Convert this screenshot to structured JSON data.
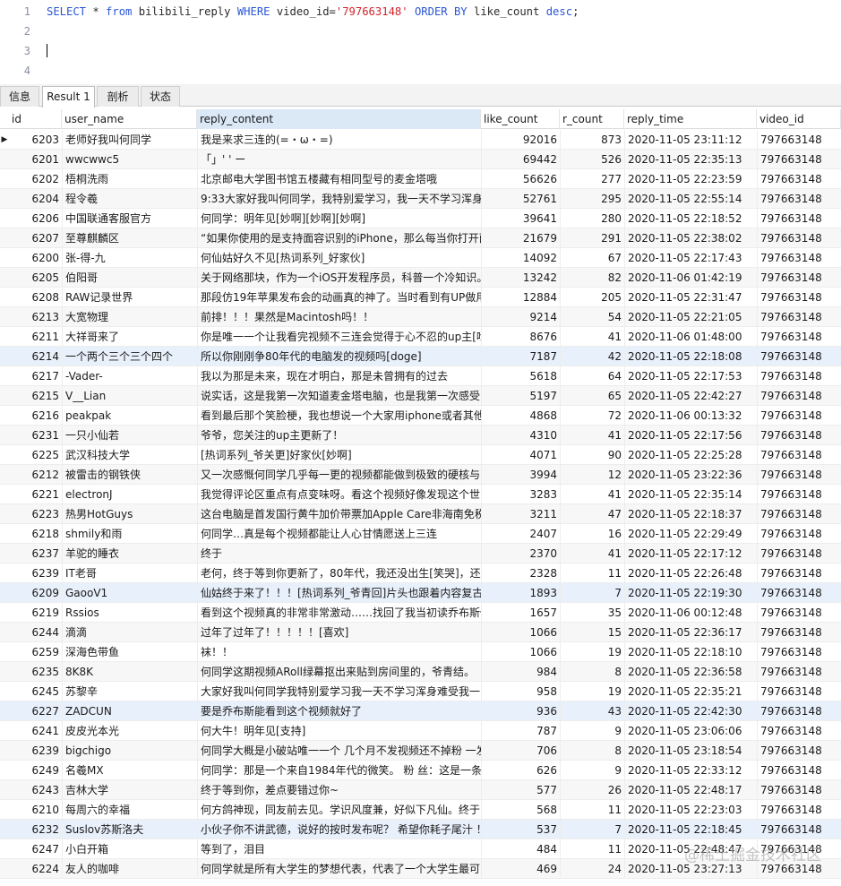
{
  "editor": {
    "lines": [
      {
        "num": "1",
        "tokens": [
          {
            "t": "SELECT",
            "c": "kw"
          },
          {
            "t": " * ",
            "c": "plain"
          },
          {
            "t": "from",
            "c": "kw"
          },
          {
            "t": " bilibili_reply ",
            "c": "plain"
          },
          {
            "t": "WHERE",
            "c": "kw"
          },
          {
            "t": " video_id=",
            "c": "plain"
          },
          {
            "t": "'797663148'",
            "c": "str"
          },
          {
            "t": " ",
            "c": "plain"
          },
          {
            "t": "ORDER BY",
            "c": "kw"
          },
          {
            "t": " like_count ",
            "c": "plain"
          },
          {
            "t": "desc",
            "c": "kw"
          },
          {
            "t": ";",
            "c": "plain"
          }
        ]
      },
      {
        "num": "2",
        "tokens": []
      },
      {
        "num": "3",
        "tokens": []
      },
      {
        "num": "4",
        "tokens": []
      }
    ]
  },
  "tabs": [
    "信息",
    "Result 1",
    "剖析",
    "状态"
  ],
  "columns": [
    "id",
    "user_name",
    "reply_content",
    "like_count",
    "r_count",
    "reply_time",
    "video_id"
  ],
  "row_pointer": "▶",
  "rows": [
    [
      "6203",
      "老师好我叫何同学",
      "我是来求三连的(=・ω・=)",
      "92016",
      "873",
      "2020-11-05 23:11:12",
      "797663148"
    ],
    [
      "6201",
      "wwcwwc5",
      "「」' ' ー",
      "69442",
      "526",
      "2020-11-05 22:35:13",
      "797663148"
    ],
    [
      "6202",
      "梧桐洗雨",
      "北京邮电大学图书馆五楼藏有相同型号的麦金塔哦",
      "56626",
      "277",
      "2020-11-05 22:23:59",
      "797663148"
    ],
    [
      "6204",
      "程令羲",
      "9:33大家好我叫何同学，我特别爱学习，我一天不学习浑身",
      "52761",
      "295",
      "2020-11-05 22:55:14",
      "797663148"
    ],
    [
      "6206",
      "中国联通客服官方",
      "何同学：明年见[妙啊][妙啊][妙啊]",
      "39641",
      "280",
      "2020-11-05 22:18:52",
      "797663148"
    ],
    [
      "6207",
      "至尊麒麟区",
      "“如果你使用的是支持面容识别的iPhone，那么每当你打开面",
      "21679",
      "291",
      "2020-11-05 22:38:02",
      "797663148"
    ],
    [
      "6200",
      "张-得-九",
      "何仙姑好久不见[热词系列_好家伙]",
      "14092",
      "67",
      "2020-11-05 22:17:43",
      "797663148"
    ],
    [
      "6205",
      "伯阳哥",
      "关于网络那块，作为一个iOS开发程序员，科普一个冷知识。",
      "13242",
      "82",
      "2020-11-06 01:42:19",
      "797663148"
    ],
    [
      "6208",
      "RAW记录世界",
      "那段仿19年苹果发布会的动画真的神了。当时看到有UP做用",
      "12884",
      "205",
      "2020-11-05 22:31:47",
      "797663148"
    ],
    [
      "6213",
      "大宽物理",
      "前排！！！果然是Macintosh吗！！",
      "9214",
      "54",
      "2020-11-05 22:21:05",
      "797663148"
    ],
    [
      "6211",
      "大祥哥来了",
      "你是唯一一个让我看完视频不三连会觉得于心不忍的up主[吃",
      "8676",
      "41",
      "2020-11-06 01:48:00",
      "797663148"
    ],
    [
      "6214",
      "一个两个三个三个四个",
      "所以你刚刚争80年代的电脑发的视频吗[doge]",
      "7187",
      "42",
      "2020-11-05 22:18:08",
      "797663148"
    ],
    [
      "6217",
      "-Vader-",
      "我以为那是未来，现在才明白，那是未曾拥有的过去",
      "5618",
      "64",
      "2020-11-05 22:17:53",
      "797663148"
    ],
    [
      "6215",
      "V__Lian",
      "说实话，这是我第一次知道麦金塔电脑，也是我第一次感受",
      "5197",
      "65",
      "2020-11-05 22:42:27",
      "797663148"
    ],
    [
      "6216",
      "peakpak",
      "看到最后那个笑脸梗，我也想说一个大家用iphone或者其他",
      "4868",
      "72",
      "2020-11-06 00:13:32",
      "797663148"
    ],
    [
      "6231",
      "一只小仙若",
      "爷爷，您关注的up主更新了！",
      "4310",
      "41",
      "2020-11-05 22:17:56",
      "797663148"
    ],
    [
      "6225",
      "武汉科技大学",
      "[热词系列_爷关更]好家伙[妙啊]",
      "4071",
      "90",
      "2020-11-05 22:25:28",
      "797663148"
    ],
    [
      "6212",
      "被雷击的钢铁侠",
      "又一次感慨何同学几乎每一更的视频都能做到极致的硬核与",
      "3994",
      "12",
      "2020-11-05 23:22:36",
      "797663148"
    ],
    [
      "6221",
      "electronJ",
      "我觉得评论区重点有点变味呀。看这个视频好像发现这个世",
      "3283",
      "41",
      "2020-11-05 22:35:14",
      "797663148"
    ],
    [
      "6223",
      "热男HotGuys",
      "这台电脑是首发国行黄牛加价带票加Apple Care非海南免税",
      "3211",
      "47",
      "2020-11-05 22:18:37",
      "797663148"
    ],
    [
      "6218",
      "shmily和雨",
      "何同学…真是每个视频都能让人心甘情愿送上三连",
      "2407",
      "16",
      "2020-11-05 22:29:49",
      "797663148"
    ],
    [
      "6237",
      "羊驼的睡衣",
      "终于",
      "2370",
      "41",
      "2020-11-05 22:17:12",
      "797663148"
    ],
    [
      "6239",
      "IT老哥",
      "老何，终于等到你更新了，80年代，我还没出生[笑哭]，还",
      "2328",
      "11",
      "2020-11-05 22:26:48",
      "797663148"
    ],
    [
      "6209",
      "GaooV1",
      "仙姑终于来了！！！[热词系列_爷青回]片头也跟着内容复古",
      "1893",
      "7",
      "2020-11-05 22:19:30",
      "797663148"
    ],
    [
      "6219",
      "Rssios",
      "看到这个视频真的非常非常激动……找回了我当初读乔布斯传",
      "1657",
      "35",
      "2020-11-06 00:12:48",
      "797663148"
    ],
    [
      "6244",
      "滴滴",
      "过年了过年了！！！！！[喜欢]",
      "1066",
      "15",
      "2020-11-05 22:36:17",
      "797663148"
    ],
    [
      "6259",
      "深海色带鱼",
      "袜！！",
      "1066",
      "19",
      "2020-11-05 22:18:10",
      "797663148"
    ],
    [
      "6235",
      "8K8K",
      "何同学这期视频ARoll绿幕抠出来贴到房间里的，爷青结。",
      "984",
      "8",
      "2020-11-05 22:36:58",
      "797663148"
    ],
    [
      "6245",
      "苏黎辛",
      "大家好我叫何同学我特别爱学习我一天不学习浑身难受我一",
      "958",
      "19",
      "2020-11-05 22:35:21",
      "797663148"
    ],
    [
      "6227",
      "ZADCUN",
      "要是乔布斯能看到这个视频就好了",
      "936",
      "43",
      "2020-11-05 22:42:30",
      "797663148"
    ],
    [
      "6241",
      "皮皮光本光",
      "何大牛！明年见[支持]",
      "787",
      "9",
      "2020-11-05 23:06:06",
      "797663148"
    ],
    [
      "6239",
      "bigchigo",
      "何同学大概是小破站唯一一个 几个月不发视频还不掉粉 一发",
      "706",
      "8",
      "2020-11-05 23:18:54",
      "797663148"
    ],
    [
      "6249",
      "名羲MX",
      "何同学：那是一个来自1984年代的微笑。 粉 丝：这是一条",
      "626",
      "9",
      "2020-11-05 22:33:12",
      "797663148"
    ],
    [
      "6243",
      "吉林大学",
      "终于等到你，差点要错过你~",
      "577",
      "26",
      "2020-11-05 22:48:17",
      "797663148"
    ],
    [
      "6210",
      "每周六的幸福",
      "何方鸽神现，同友前去见。学识风度兼，好似下凡仙。终于",
      "568",
      "11",
      "2020-11-05 22:23:03",
      "797663148"
    ],
    [
      "6232",
      "Suslov苏斯洛夫",
      "小伙子你不讲武德，说好的按时发布呢？ 希望你耗子尾汁 ！",
      "537",
      "7",
      "2020-11-05 22:18:45",
      "797663148"
    ],
    [
      "6247",
      "小白开箱",
      "等到了，泪目",
      "484",
      "11",
      "2020-11-05 22:48:47",
      "797663148"
    ],
    [
      "6224",
      "友人的咖啡",
      "何同学就是所有大学生的梦想代表，代表了一个大学生最可",
      "469",
      "24",
      "2020-11-05 23:27:13",
      "797663148"
    ]
  ],
  "watermark": "@稀土掘金技术社区"
}
